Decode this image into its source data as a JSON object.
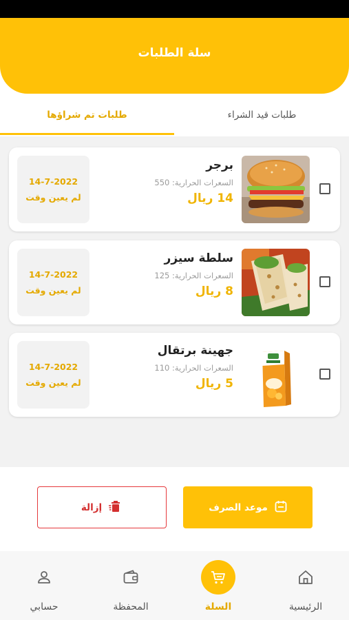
{
  "header": {
    "title": "سلة الطلبات"
  },
  "tabs": [
    {
      "label": "طلبات تم شراؤها"
    },
    {
      "label": "طلبات قيد الشراء"
    }
  ],
  "orders": [
    {
      "name": "برجر",
      "calories": "السعرات الحرارية: 550",
      "price": "14 ريال",
      "date": "14-7-2022",
      "time_status": "لم يعين وقت",
      "image": "burger-image"
    },
    {
      "name": "سلطة سيزر",
      "calories": "السعرات الحرارية: 125",
      "price": "8 ريال",
      "date": "14-7-2022",
      "time_status": "لم يعين وقت",
      "image": "wrap-image"
    },
    {
      "name": "جهينة برتقال",
      "calories": "السعرات الحرارية: 110",
      "price": "5 ريال",
      "date": "14-7-2022",
      "time_status": "لم يعين وقت",
      "image": "juice-box-image"
    }
  ],
  "actions": {
    "schedule_label": "موعد الصرف",
    "remove_label": "إزالة"
  },
  "nav": [
    {
      "label": "الرئيسية",
      "icon": "home-icon"
    },
    {
      "label": "السلة",
      "icon": "cart-icon"
    },
    {
      "label": "المحفظة",
      "icon": "wallet-icon"
    },
    {
      "label": "حسابي",
      "icon": "user-icon"
    }
  ],
  "colors": {
    "accent": "#ffc107",
    "accent_text": "#e4a900",
    "danger": "#e5383b"
  }
}
